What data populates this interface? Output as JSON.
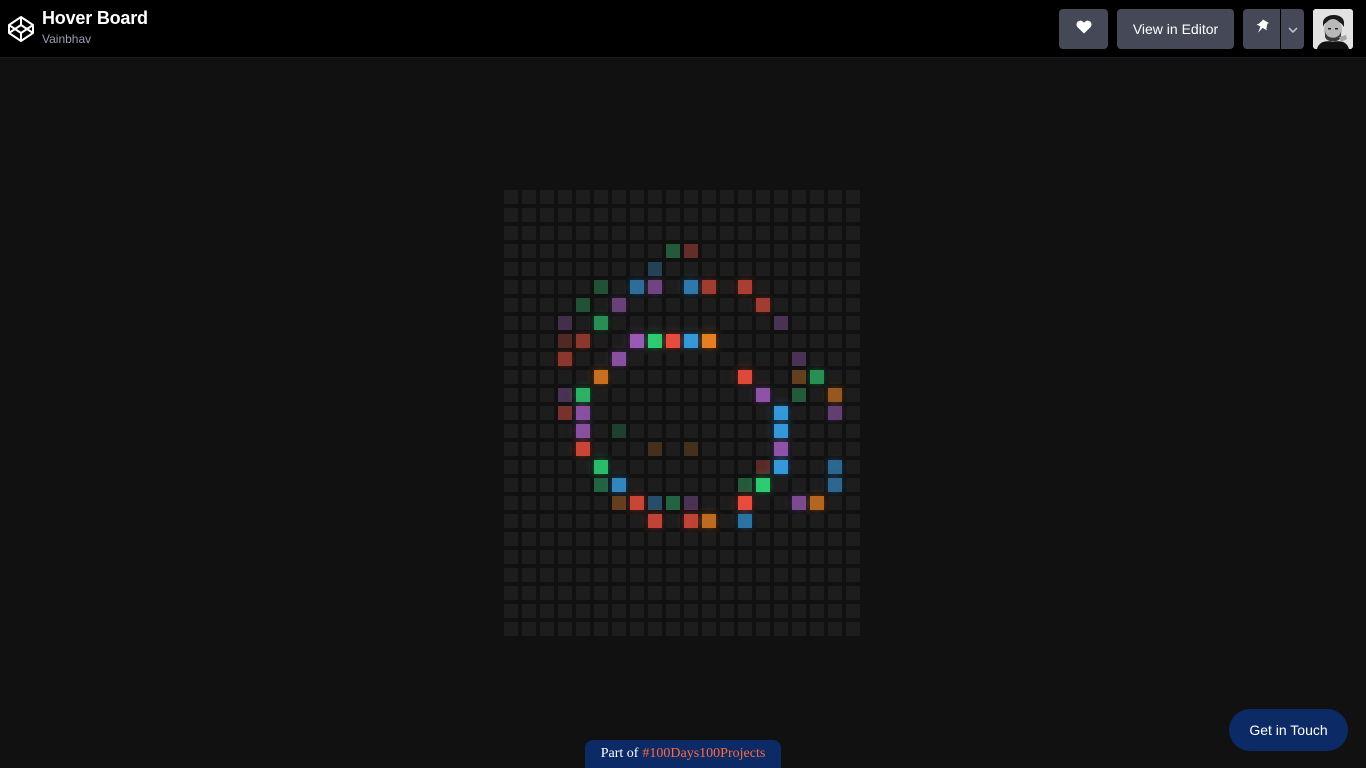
{
  "header": {
    "title": "Hover Board",
    "author": "Vainbhav",
    "view_in_editor_label": "View in Editor",
    "icons": [
      "codepen-logo-icon",
      "heart-icon",
      "pin-icon",
      "chevron-down-icon"
    ]
  },
  "board": {
    "columns": 20,
    "rows": 25,
    "cell_color": "#1d1d1d",
    "palette": {
      "r": "#e74c3c",
      "g": "#2ecc71",
      "b": "#3498db",
      "p": "#9b59b6",
      "o": "#e67e22"
    },
    "lit_cells": [
      {
        "row": 3,
        "col": 9,
        "color": "g",
        "level": 0.35
      },
      {
        "row": 3,
        "col": 10,
        "color": "r",
        "level": 0.35
      },
      {
        "row": 4,
        "col": 8,
        "color": "b",
        "level": 0.3
      },
      {
        "row": 5,
        "col": 5,
        "color": "g",
        "level": 0.3
      },
      {
        "row": 5,
        "col": 7,
        "color": "b",
        "level": 0.65
      },
      {
        "row": 5,
        "col": 8,
        "color": "p",
        "level": 0.65
      },
      {
        "row": 5,
        "col": 10,
        "color": "b",
        "level": 0.75
      },
      {
        "row": 5,
        "col": 11,
        "color": "r",
        "level": 0.65
      },
      {
        "row": 5,
        "col": 13,
        "color": "r",
        "level": 0.7
      },
      {
        "row": 6,
        "col": 4,
        "color": "g",
        "level": 0.3
      },
      {
        "row": 6,
        "col": 6,
        "color": "p",
        "level": 0.6
      },
      {
        "row": 6,
        "col": 14,
        "color": "r",
        "level": 0.65
      },
      {
        "row": 7,
        "col": 3,
        "color": "p",
        "level": 0.3
      },
      {
        "row": 7,
        "col": 5,
        "color": "g",
        "level": 0.65
      },
      {
        "row": 7,
        "col": 15,
        "color": "p",
        "level": 0.35
      },
      {
        "row": 8,
        "col": 3,
        "color": "r",
        "level": 0.25
      },
      {
        "row": 8,
        "col": 4,
        "color": "r",
        "level": 0.55
      },
      {
        "row": 8,
        "col": 7,
        "color": "p",
        "level": 1
      },
      {
        "row": 8,
        "col": 8,
        "color": "g",
        "level": 1
      },
      {
        "row": 8,
        "col": 9,
        "color": "r",
        "level": 1
      },
      {
        "row": 8,
        "col": 10,
        "color": "b",
        "level": 1
      },
      {
        "row": 8,
        "col": 11,
        "color": "o",
        "level": 1
      },
      {
        "row": 9,
        "col": 3,
        "color": "r",
        "level": 0.55
      },
      {
        "row": 9,
        "col": 6,
        "color": "p",
        "level": 0.85
      },
      {
        "row": 9,
        "col": 16,
        "color": "p",
        "level": 0.35
      },
      {
        "row": 10,
        "col": 5,
        "color": "o",
        "level": 0.85
      },
      {
        "row": 10,
        "col": 13,
        "color": "r",
        "level": 0.95
      },
      {
        "row": 10,
        "col": 16,
        "color": "o",
        "level": 0.35
      },
      {
        "row": 10,
        "col": 17,
        "color": "g",
        "level": 0.65
      },
      {
        "row": 11,
        "col": 3,
        "color": "p",
        "level": 0.35
      },
      {
        "row": 11,
        "col": 4,
        "color": "g",
        "level": 0.85
      },
      {
        "row": 11,
        "col": 14,
        "color": "p",
        "level": 0.9
      },
      {
        "row": 11,
        "col": 16,
        "color": "g",
        "level": 0.35
      },
      {
        "row": 11,
        "col": 18,
        "color": "o",
        "level": 0.6
      },
      {
        "row": 12,
        "col": 3,
        "color": "r",
        "level": 0.45
      },
      {
        "row": 12,
        "col": 4,
        "color": "p",
        "level": 0.85
      },
      {
        "row": 12,
        "col": 15,
        "color": "b",
        "level": 1
      },
      {
        "row": 12,
        "col": 18,
        "color": "p",
        "level": 0.55
      },
      {
        "row": 13,
        "col": 4,
        "color": "p",
        "level": 0.85
      },
      {
        "row": 13,
        "col": 6,
        "color": "g",
        "level": 0.2
      },
      {
        "row": 13,
        "col": 15,
        "color": "b",
        "level": 1
      },
      {
        "row": 14,
        "col": 4,
        "color": "r",
        "level": 0.85
      },
      {
        "row": 14,
        "col": 8,
        "color": "o",
        "level": 0.2
      },
      {
        "row": 14,
        "col": 10,
        "color": "o",
        "level": 0.2
      },
      {
        "row": 14,
        "col": 15,
        "color": "p",
        "level": 0.9
      },
      {
        "row": 15,
        "col": 5,
        "color": "g",
        "level": 0.9
      },
      {
        "row": 15,
        "col": 14,
        "color": "r",
        "level": 0.3
      },
      {
        "row": 15,
        "col": 15,
        "color": "b",
        "level": 1
      },
      {
        "row": 15,
        "col": 18,
        "color": "b",
        "level": 0.6
      },
      {
        "row": 16,
        "col": 5,
        "color": "g",
        "level": 0.4
      },
      {
        "row": 16,
        "col": 6,
        "color": "b",
        "level": 0.85
      },
      {
        "row": 16,
        "col": 13,
        "color": "g",
        "level": 0.35
      },
      {
        "row": 16,
        "col": 14,
        "color": "g",
        "level": 1
      },
      {
        "row": 16,
        "col": 18,
        "color": "b",
        "level": 0.6
      },
      {
        "row": 17,
        "col": 6,
        "color": "o",
        "level": 0.35
      },
      {
        "row": 17,
        "col": 7,
        "color": "r",
        "level": 0.85
      },
      {
        "row": 17,
        "col": 8,
        "color": "b",
        "level": 0.4
      },
      {
        "row": 17,
        "col": 9,
        "color": "g",
        "level": 0.4
      },
      {
        "row": 17,
        "col": 10,
        "color": "p",
        "level": 0.35
      },
      {
        "row": 17,
        "col": 13,
        "color": "r",
        "level": 1
      },
      {
        "row": 17,
        "col": 16,
        "color": "p",
        "level": 0.75
      },
      {
        "row": 17,
        "col": 17,
        "color": "o",
        "level": 0.75
      },
      {
        "row": 18,
        "col": 8,
        "color": "r",
        "level": 0.8
      },
      {
        "row": 18,
        "col": 10,
        "color": "r",
        "level": 0.8
      },
      {
        "row": 18,
        "col": 11,
        "color": "o",
        "level": 0.8
      },
      {
        "row": 18,
        "col": 13,
        "color": "b",
        "level": 0.7
      }
    ]
  },
  "footer": {
    "badge_prefix": "Part of",
    "badge_tag": "#100Days100Projects",
    "tag_color": "#ff6b3d",
    "contact_label": "Get in Touch"
  }
}
